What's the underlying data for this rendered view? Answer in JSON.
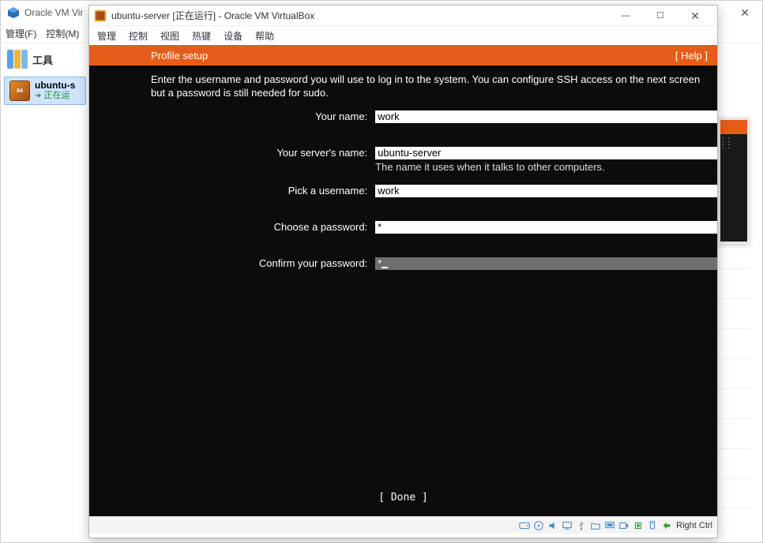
{
  "outer": {
    "title": "Oracle VM Vir",
    "menu": {
      "file": "管理(F)",
      "control": "控制(M)"
    },
    "tools_label": "工具",
    "vm_entry": {
      "name": "ubuntu-s",
      "status": "正在运"
    },
    "close_glyph": "✕"
  },
  "vm": {
    "title": "ubuntu-server [正在运行] - Oracle VM VirtualBox",
    "menu": {
      "m1": "管理",
      "m2": "控制",
      "m3": "视图",
      "m4": "热键",
      "m5": "设备",
      "m6": "帮助"
    },
    "min_glyph": "—",
    "max_glyph": "☐",
    "close_glyph": "✕",
    "host_key": "Right Ctrl"
  },
  "console": {
    "header_title": "Profile setup",
    "header_help": "[ Help ]",
    "instruction": "Enter the username and password you will use to log in to the system. You can configure SSH access on the next screen but a password is still needed for sudo.",
    "labels": {
      "name": "Your name:",
      "server": "Your server's name:",
      "server_hint": "The name it uses when it talks to other computers.",
      "username": "Pick a username:",
      "password": "Choose a password:",
      "confirm": "Confirm your password:"
    },
    "values": {
      "name": "work",
      "server": "ubuntu-server",
      "username": "work",
      "password": "*",
      "confirm": "*"
    },
    "done": "[ Done       ]"
  }
}
